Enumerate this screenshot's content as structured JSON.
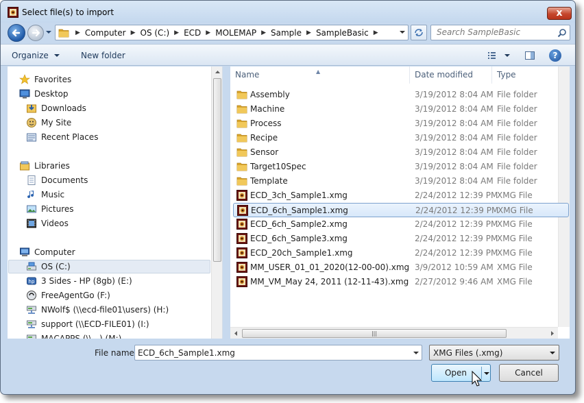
{
  "window": {
    "title": "Select file(s) to import",
    "close_label": "x"
  },
  "breadcrumb": [
    "Computer",
    "OS (C:)",
    "ECD",
    "MOLEMAP",
    "Sample",
    "SampleBasic"
  ],
  "search": {
    "placeholder": "Search SampleBasic"
  },
  "toolbar": {
    "organize": "Organize",
    "new_folder": "New folder",
    "help": "?"
  },
  "nav": {
    "items": [
      {
        "label": "Favorites",
        "icon": "star-icon"
      },
      {
        "label": "Desktop",
        "icon": "desktop-icon"
      },
      {
        "label": "Downloads",
        "icon": "downloads-icon"
      },
      {
        "label": "My Site",
        "icon": "mysite-icon"
      },
      {
        "label": "Recent Places",
        "icon": "recent-places-icon"
      },
      {
        "label": "Libraries",
        "icon": "libraries-icon"
      },
      {
        "label": "Documents",
        "icon": "documents-icon"
      },
      {
        "label": "Music",
        "icon": "music-icon"
      },
      {
        "label": "Pictures",
        "icon": "pictures-icon"
      },
      {
        "label": "Videos",
        "icon": "videos-icon"
      },
      {
        "label": "Computer",
        "icon": "computer-icon"
      },
      {
        "label": "OS (C:)",
        "icon": "drive-icon"
      },
      {
        "label": "3 Sides - HP (8gb) (E:)",
        "icon": "usb-drive-icon"
      },
      {
        "label": "FreeAgentGo (F:)",
        "icon": "external-drive-icon"
      },
      {
        "label": "NWolf$ (\\\\ecd-file01\\users) (H:)",
        "icon": "network-drive-icon"
      },
      {
        "label": "support (\\\\ECD-FILE01) (I:)",
        "icon": "network-drive-icon"
      },
      {
        "label": "MACAPPS (\\\\...) (M:)",
        "icon": "network-drive-icon"
      }
    ]
  },
  "columns": {
    "name": "Name",
    "date": "Date modified",
    "type": "Type"
  },
  "files": [
    {
      "name": "Assembly",
      "date": "3/19/2012 8:04 AM",
      "type": "File folder",
      "icon": "folder-icon"
    },
    {
      "name": "Machine",
      "date": "3/19/2012 8:04 AM",
      "type": "File folder",
      "icon": "folder-icon"
    },
    {
      "name": "Process",
      "date": "3/19/2012 8:04 AM",
      "type": "File folder",
      "icon": "folder-icon"
    },
    {
      "name": "Recipe",
      "date": "3/19/2012 8:04 AM",
      "type": "File folder",
      "icon": "folder-icon"
    },
    {
      "name": "Sensor",
      "date": "3/19/2012 8:04 AM",
      "type": "File folder",
      "icon": "folder-icon"
    },
    {
      "name": "Target10Spec",
      "date": "3/19/2012 8:04 AM",
      "type": "File folder",
      "icon": "folder-icon"
    },
    {
      "name": "Template",
      "date": "3/19/2012 8:04 AM",
      "type": "File folder",
      "icon": "folder-icon"
    },
    {
      "name": "ECD_3ch_Sample1.xmg",
      "date": "2/24/2012 12:39 PM",
      "type": "XMG File",
      "icon": "xmg-file-icon"
    },
    {
      "name": "ECD_6ch_Sample1.xmg",
      "date": "2/24/2012 12:39 PM",
      "type": "XMG File",
      "icon": "xmg-file-icon",
      "selected": true
    },
    {
      "name": "ECD_6ch_Sample2.xmg",
      "date": "2/24/2012 12:39 PM",
      "type": "XMG File",
      "icon": "xmg-file-icon"
    },
    {
      "name": "ECD_6ch_Sample3.xmg",
      "date": "2/24/2012 12:39 PM",
      "type": "XMG File",
      "icon": "xmg-file-icon"
    },
    {
      "name": "ECD_20ch_Sample1.xmg",
      "date": "2/24/2012 12:39 PM",
      "type": "XMG File",
      "icon": "xmg-file-icon"
    },
    {
      "name": "MM_USER_01_01_2020(12-00-00).xmg",
      "date": "3/9/2012 10:59 AM",
      "type": "XMG File",
      "icon": "xmg-file-icon"
    },
    {
      "name": "MM_VM_May 24, 2011 (12-11-43).xmg",
      "date": "2/27/2012 9:46 AM",
      "type": "XMG File",
      "icon": "xmg-file-icon"
    }
  ],
  "footer": {
    "filename_label": "File name:",
    "filename_value": "ECD_6ch_Sample1.xmg",
    "filetype_value": "XMG Files (.xmg)",
    "open_label": "Open",
    "cancel_label": "Cancel"
  },
  "colors": {
    "selection": "#d8e8fa",
    "selection_border": "#7da2ce",
    "folder": "#e8b83e",
    "accent": "#1f5aa8"
  }
}
